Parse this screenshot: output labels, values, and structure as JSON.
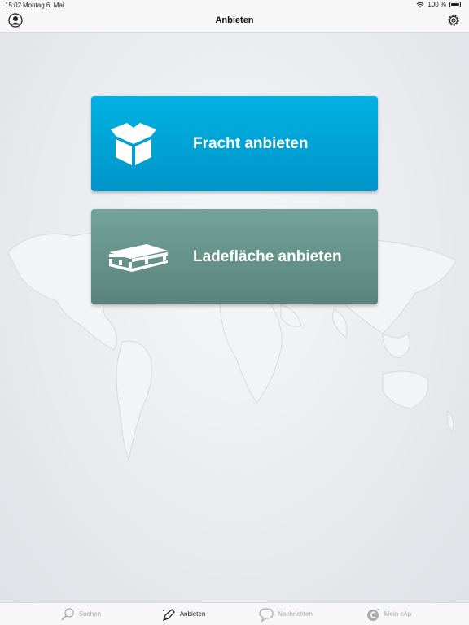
{
  "status_bar": {
    "time": "15:02",
    "date": "Montag 6. Mai",
    "battery": "100 %"
  },
  "nav": {
    "title": "Anbieten",
    "left_icon": "profile-icon",
    "right_icon": "gear-icon"
  },
  "actions": [
    {
      "label": "Fracht anbieten",
      "icon": "box-icon",
      "color": "#00a5d9"
    },
    {
      "label": "Ladefläche anbieten",
      "icon": "pallet-icon",
      "color": "#66938b"
    }
  ],
  "tabs": [
    {
      "label": "Suchen",
      "icon": "search-icon",
      "active": false
    },
    {
      "label": "Anbieten",
      "icon": "pen-icon",
      "active": true
    },
    {
      "label": "Nachrichten",
      "icon": "chat-icon",
      "active": false
    },
    {
      "label": "Mein cAp",
      "icon": "cap-logo-icon",
      "active": false
    }
  ]
}
